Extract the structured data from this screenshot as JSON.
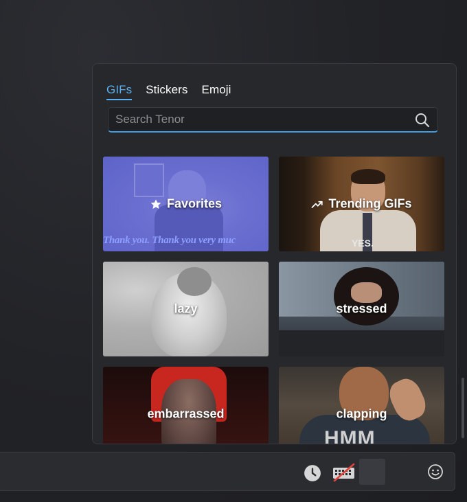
{
  "tabs": [
    {
      "label": "GIFs",
      "active": true
    },
    {
      "label": "Stickers",
      "active": false
    },
    {
      "label": "Emoji",
      "active": false
    }
  ],
  "search": {
    "placeholder": "Search Tenor",
    "icon": "search-icon"
  },
  "tiles": [
    {
      "label": "Favorites",
      "icon": "star-icon",
      "overlay_text": "Thank you. Thank you very muc"
    },
    {
      "label": "Trending GIFs",
      "icon": "trending-up-icon",
      "overlay_text": "YES."
    },
    {
      "label": "lazy"
    },
    {
      "label": "stressed"
    },
    {
      "label": "embarrassed"
    },
    {
      "label": "clapping",
      "overlay_text": "HMM"
    }
  ],
  "composer": {
    "icons": [
      "clock-icon",
      "keyboard-off-icon",
      "emoji-icon"
    ]
  },
  "colors": {
    "accent": "#5ab0f0",
    "panel_bg": "#27282c",
    "favorites_tint": "#6b6fd0",
    "disabled_slash": "#e0443a"
  }
}
